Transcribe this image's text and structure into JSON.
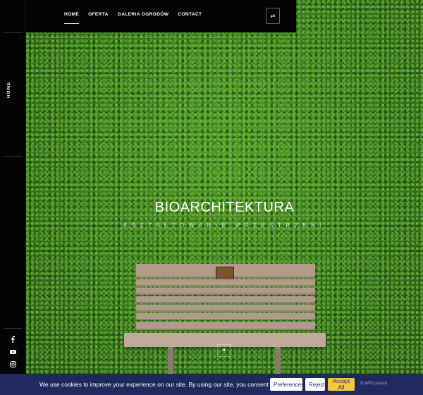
{
  "nav": {
    "items": [
      {
        "label": "HOME",
        "active": true
      },
      {
        "label": "OFERTA",
        "active": false
      },
      {
        "label": "GALERIA OGRODÓW",
        "active": false
      },
      {
        "label": "CONTACT",
        "active": false
      }
    ],
    "menu_icon": "menu-toggle-icon"
  },
  "sidebar": {
    "home_label": "HOME",
    "social": [
      "facebook-icon",
      "youtube-icon",
      "instagram-icon"
    ]
  },
  "hero": {
    "title": "BIOARCHITEKTURA",
    "subtitle": "KSZTAŁTOWANIE PRZESTRZENI"
  },
  "cookie": {
    "text": "We use cookies to improve your experience on our site. By using our site, you consent to cookies.",
    "preferences": "Preferences",
    "reject": "Reject",
    "accept": "Accept All",
    "brand": "WPConsent"
  },
  "colors": {
    "logo_yellow": "#c8d92b",
    "cookie_bg": "#1e2a5e",
    "accept_btn": "#f6c744"
  }
}
